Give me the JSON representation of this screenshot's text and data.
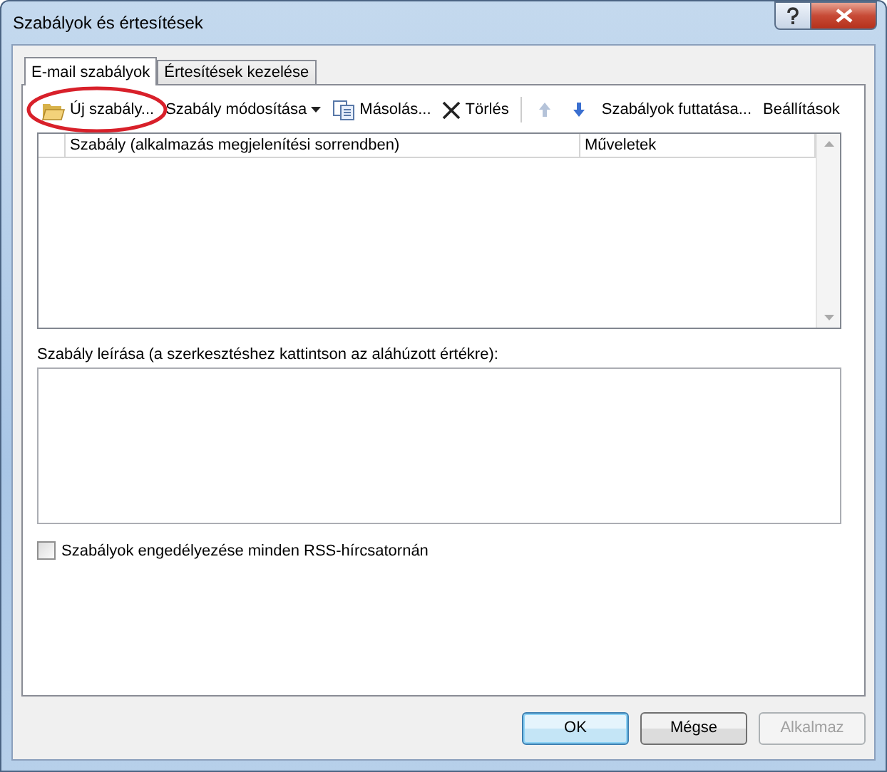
{
  "window": {
    "title": "Szabályok és értesítések"
  },
  "tabs": [
    {
      "label": "E-mail szabályok",
      "selected": true
    },
    {
      "label": "Értesítések kezelése",
      "selected": false
    }
  ],
  "toolbar": [
    {
      "kind": "new",
      "label": "Új szabály..."
    },
    {
      "kind": "dropdown",
      "label": "Szabály módosítása"
    },
    {
      "kind": "copy",
      "label": "Másolás..."
    },
    {
      "kind": "delete",
      "label": "Törlés"
    },
    {
      "kind": "separator"
    },
    {
      "kind": "up"
    },
    {
      "kind": "down"
    },
    {
      "kind": "text",
      "label": "Szabályok futtatása..."
    },
    {
      "kind": "text",
      "label": "Beállítások"
    }
  ],
  "rules_table": {
    "columns": [
      "Szabály (alkalmazás megjelenítési sorrendben)",
      "Műveletek"
    ]
  },
  "description": {
    "label": "Szabály leírása (a szerkesztéshez kattintson az aláhúzott értékre):"
  },
  "rss_checkbox": {
    "label": "Szabályok engedélyezése minden RSS-hírcsatornán",
    "checked": false
  },
  "buttons": [
    {
      "label": "OK",
      "kind": "default",
      "disabled": false
    },
    {
      "label": "Mégse",
      "kind": "normal",
      "disabled": false
    },
    {
      "label": "Alkalmaz",
      "kind": "normal",
      "disabled": true
    }
  ]
}
